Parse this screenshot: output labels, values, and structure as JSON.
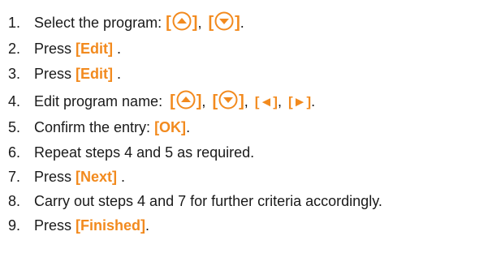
{
  "steps": [
    {
      "num": "1.",
      "text": "Select the program: ",
      "sep": ", ",
      "end": "."
    },
    {
      "num": "2.",
      "text": "Press ",
      "key": "[Edit]",
      "after": " ."
    },
    {
      "num": "3.",
      "text": "Press ",
      "key": "[Edit]",
      "after": " ."
    },
    {
      "num": "4.",
      "text": "Edit program name: ",
      "sep": ", ",
      "key_left": "[◄]",
      "key_right": "[►]",
      "end": "."
    },
    {
      "num": "5.",
      "text": "Confirm the entry: ",
      "key": "[OK]",
      "after": "."
    },
    {
      "num": "6.",
      "text": "Repeat steps 4 and 5 as required."
    },
    {
      "num": "7.",
      "text": "Press ",
      "key": "[Next]",
      "after": " ."
    },
    {
      "num": "8.",
      "text": "Carry out steps 4 and 7 for further criteria accordingly."
    },
    {
      "num": "9.",
      "text": "Press ",
      "key": "[Finished]",
      "after": "."
    }
  ],
  "icons": {
    "up": "arrow-up-circle-icon",
    "down": "arrow-down-circle-icon"
  },
  "colors": {
    "accent": "#f28a1e",
    "text": "#1a1a1a"
  }
}
